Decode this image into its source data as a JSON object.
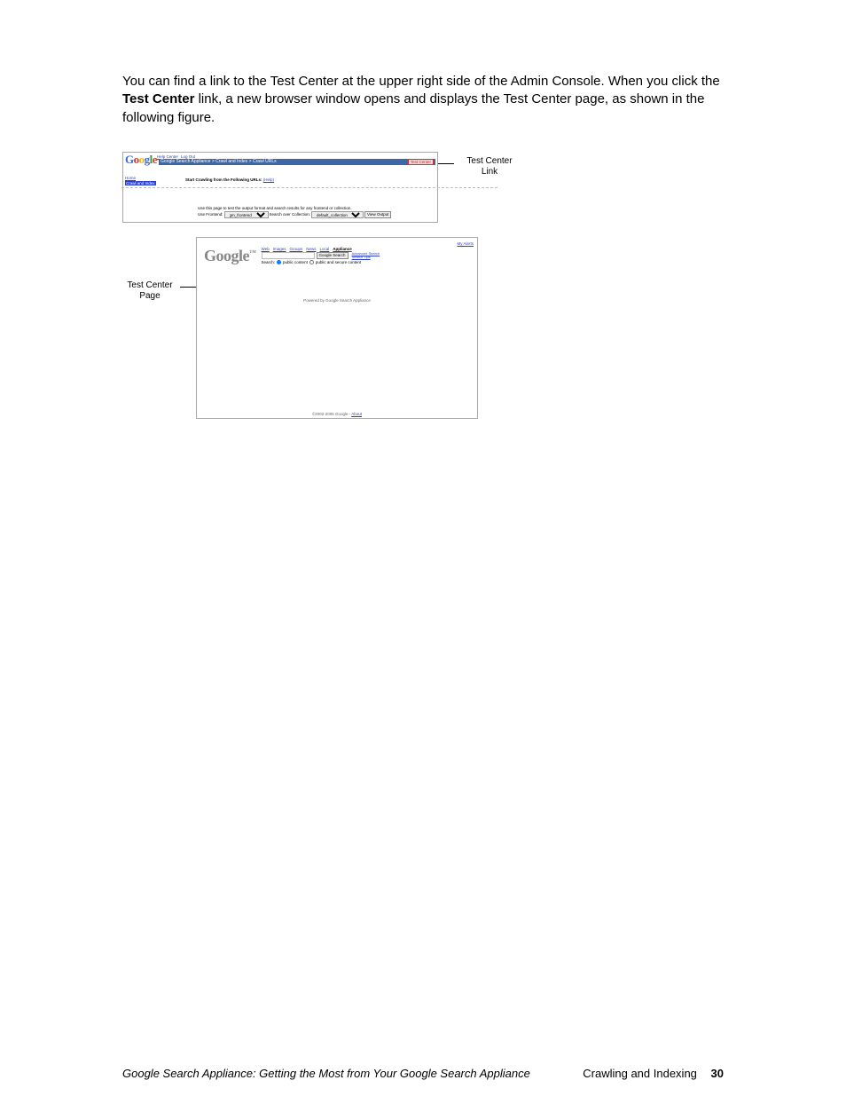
{
  "paragraph": {
    "line1": "You can find a link to the Test Center at the upper right side of the Admin Console. When you click the ",
    "bold": "Test Center",
    "line2": " link, a new browser window opens and displays the Test Center page, as shown in the following figure."
  },
  "callouts": {
    "link_label": "Test Center Link",
    "page_label": "Test Center Page"
  },
  "admin": {
    "breadcrumb": "Google Search Appliance > Crawl and Index > Crawl URLs",
    "help_center": "Help Center",
    "log_out": "Log Out",
    "test_center_btn": "Test Center",
    "nav_home": "Home",
    "nav_crawl": "Crawl and Index",
    "start_crawl_label": "Start Crawling from the Following URLs:",
    "help_link": "(Help)",
    "instruction": "Use this page to test the output format and search results for any frontend or collection.",
    "use_frontend_label": "Use Frontend:",
    "frontend_value": "gm_frontend",
    "search_over_label": "Search over Collection:",
    "collection_value": "default_collection",
    "view_output_btn": "View Output"
  },
  "tc": {
    "my_alerts": "My Alerts",
    "tabs": {
      "web": "Web",
      "images": "Images",
      "groups": "Groups",
      "news": "News",
      "local": "Local",
      "appliance": "Appliance"
    },
    "search_btn": "Google Search",
    "adv_search": "Advanced Search",
    "search_tips": "Search Tips",
    "search_label": "Search:",
    "radio_public": "public content",
    "radio_both": "public and secure content",
    "powered_by": "Powered by Google Search Appliance",
    "copyright": "©2002-2006 Google - ",
    "about": "About"
  },
  "footer": {
    "left": "Google Search Appliance: Getting the Most from Your Google Search Appliance",
    "section": "Crawling and Indexing",
    "page_num": "30"
  }
}
